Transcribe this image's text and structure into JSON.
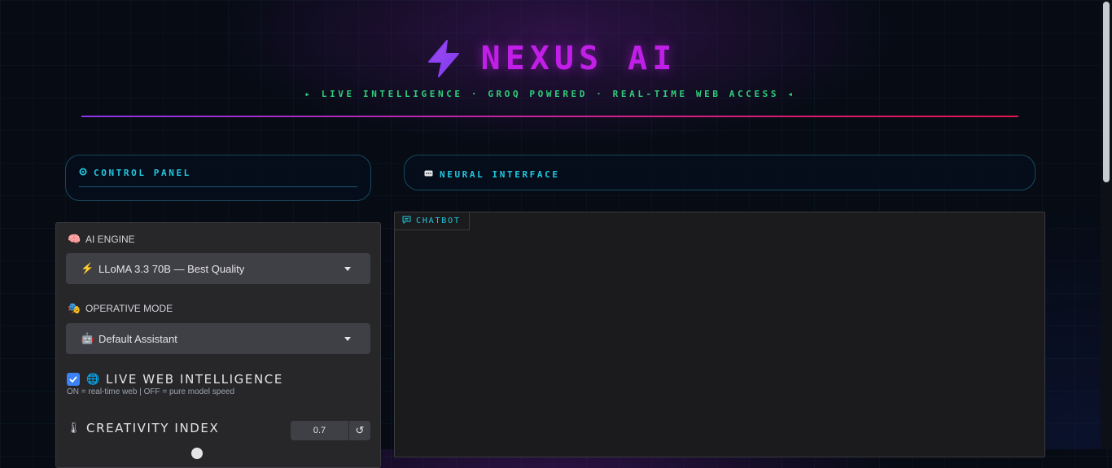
{
  "header": {
    "title": "NEXUS AI",
    "tagline": "▸ LIVE INTELLIGENCE · GROQ POWERED · REAL-TIME WEB ACCESS ◂",
    "accent_color": "#c11fe8",
    "icon": "lightning-bolt-icon"
  },
  "sections": {
    "control_panel": {
      "label": "CONTROL PANEL",
      "icon": "gear-icon"
    },
    "neural_interface": {
      "label": "NEURAL INTERFACE",
      "icon": "chat-bubble-icon"
    }
  },
  "controls": {
    "engine": {
      "label": "AI ENGINE",
      "label_emoji": "🧠",
      "selected": "LLoMA 3.3 70B — Best Quality",
      "selected_emoji": "⚡"
    },
    "mode": {
      "label": "OPERATIVE MODE",
      "label_emoji": "🎭",
      "selected": "Default Assistant",
      "selected_emoji": "🤖"
    },
    "web": {
      "label": "LIVE WEB INTELLIGENCE",
      "label_emoji": "🌐",
      "checked": true,
      "hint": "ON = real-time web | OFF = pure model speed"
    },
    "creativity": {
      "label": "CREATIVITY INDEX",
      "label_emoji": "🌡",
      "value": "0.7",
      "reset_glyph": "↺"
    }
  },
  "chatbot": {
    "label": "CHATBOT",
    "icon": "chat-icon"
  }
}
